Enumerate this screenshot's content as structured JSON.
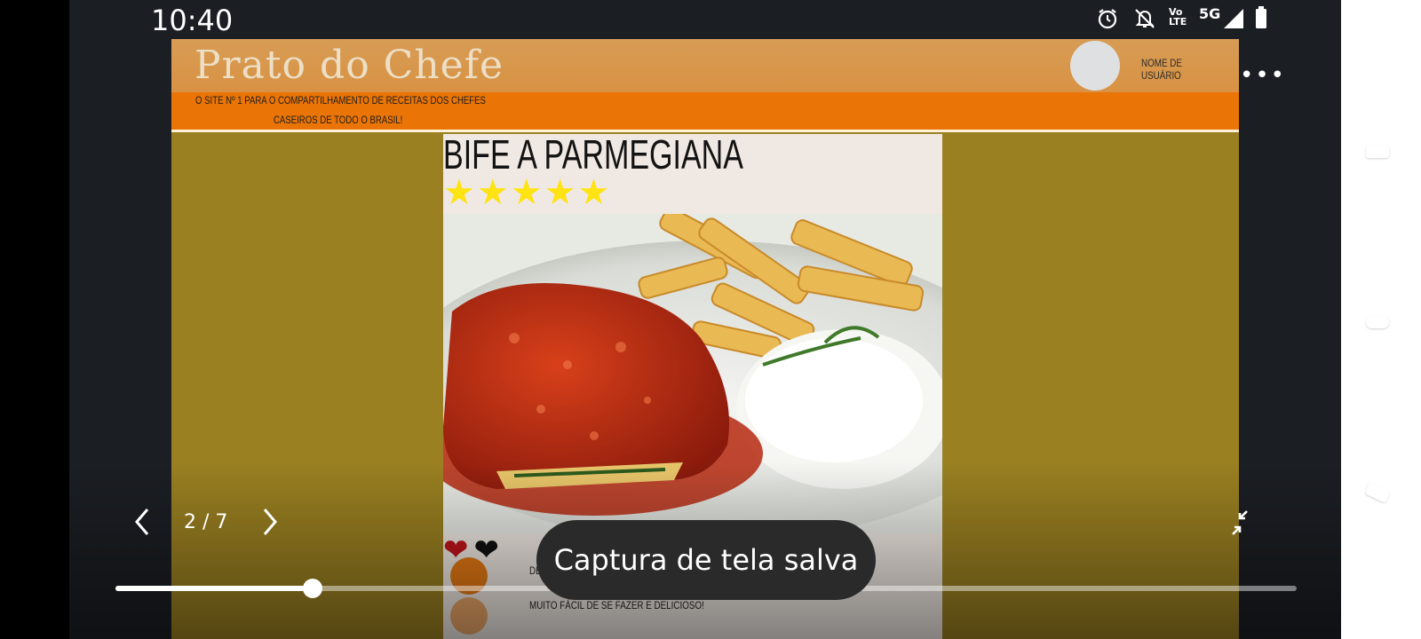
{
  "status_bar": {
    "time": "10:40",
    "icons": [
      "alarm-icon",
      "notifications-off-icon",
      "volte-icon",
      "5g-icon",
      "signal-icon",
      "battery-icon"
    ],
    "volte_label": "Vo LTE",
    "network_label": "5G"
  },
  "site": {
    "logo": "Prato do Chefe",
    "user_name": "NOME DE USUÁRIO",
    "tagline_1": "O SITE  Nº 1 PARA O COMPARTILHAMENTO DE RECEITAS DOS CHEFES",
    "tagline_2": "CASEIROS DE TODO O BRASIL!"
  },
  "recipe": {
    "title": "BIFE A PARMEGIANA",
    "rating_stars": 5,
    "stars_display": "★★★★★",
    "hearts_display": "❤ ❤",
    "comments": [
      {
        "text": "DE...OVE!"
      },
      {
        "text": "MUITO FÁCIL DE SE FAZER E DELICIOSO!"
      }
    ]
  },
  "viewer": {
    "page_indicator": "2 / 7",
    "progress_fraction": 0.167,
    "toast": "Captura de tela salva",
    "more_label": "•••"
  },
  "colors": {
    "slide_bg": "#9a8021",
    "header_gold": "#d99243",
    "header_orange": "#ea7406",
    "stars": "#ffe313",
    "heart_red": "#c0141a",
    "heart_black": "#111111"
  }
}
